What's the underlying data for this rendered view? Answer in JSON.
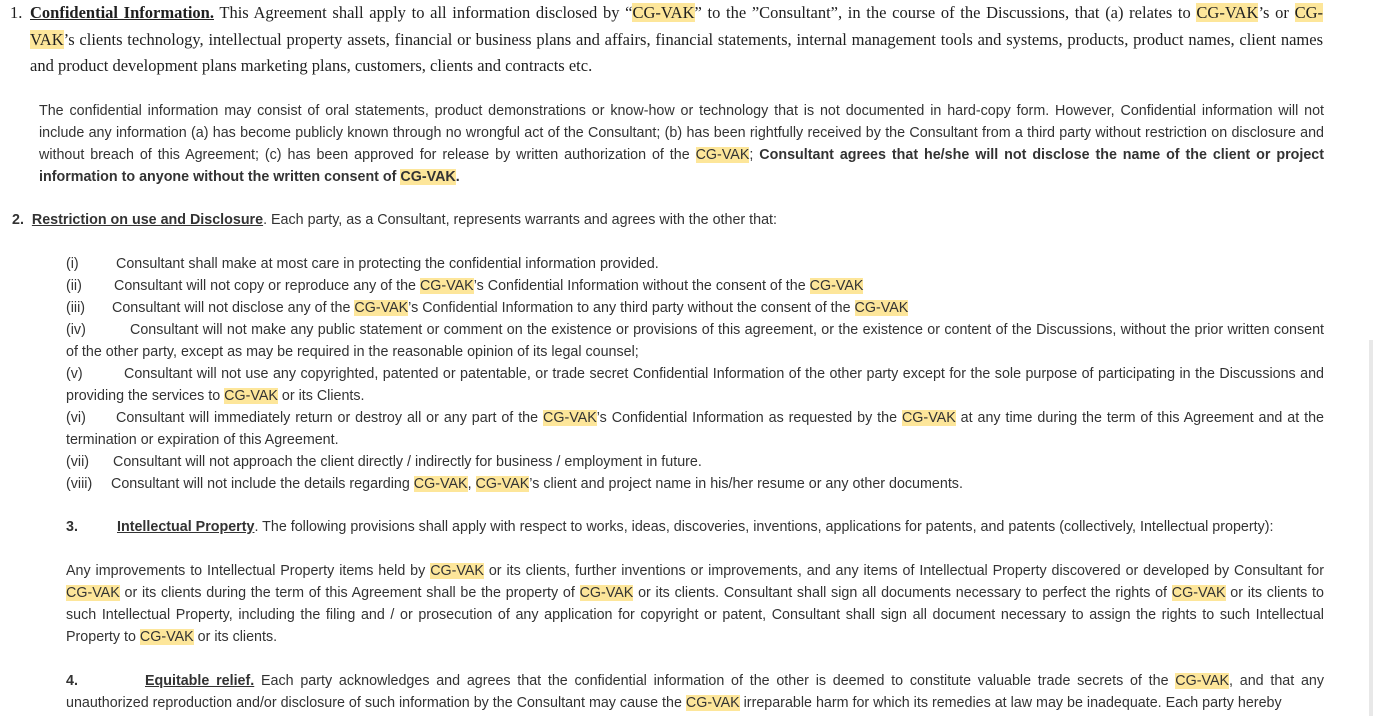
{
  "hl": "CG-VAK",
  "s1": {
    "num": "1.",
    "heading": "Confidential Information.",
    "text_a": " This Agreement shall apply to all information disclosed by  “",
    "text_b": "” to the ”Consultant”, in the course of the Discussions, that (a) relates to ",
    "text_c": "’s or ",
    "text_d": "’s clients technology, intellectual property assets, financial or business plans and affairs, financial statements, internal management tools and systems, products, product names, client names and product development plans marketing plans, customers, clients and contracts etc."
  },
  "p2": {
    "a": "The confidential information may consist of oral statements, product demonstrations or know-how or technology that is not documented in hard-copy form. However, Confidential information will not include any information (a) has become publicly known through no wrongful act of the Consultant; (b) has been rightfully received by the Consultant from a third party without restriction on disclosure and without breach of this Agreement; (c) has been approved for release by written authorization of the ",
    "b": "; ",
    "bold": "Consultant agrees that he/she will not disclose the name of the client or project information to anyone without the written consent of ",
    "end": "."
  },
  "s2": {
    "num": "2.",
    "heading": "Restriction on use and Disclosure",
    "text": ". Each party, as a Consultant, represents warrants and agrees with the other that:"
  },
  "items": {
    "i": {
      "n": "(i)",
      "t": "Consultant shall make at most care in protecting the confidential information provided."
    },
    "ii": {
      "n": "(ii)",
      "a": "Consultant will not copy or reproduce any of the ",
      "b": "’s Confidential Information without the consent of the "
    },
    "iii": {
      "n": "(iii)",
      "a": "Consultant will not disclose any of the ",
      "b": "’s Confidential Information to any third party without the consent of the "
    },
    "iv": {
      "n": "(iv)",
      "t": "Consultant will not make any public statement or comment on the existence or provisions of this agreement, or the existence or content of the Discussions, without the prior written consent of the other party, except as may be required in the reasonable opinion of its legal counsel;"
    },
    "v": {
      "n": "(v)",
      "a": "Consultant will not use any copyrighted, patented or patentable, or trade secret Confidential Information of the other party except for the sole purpose of participating in the Discussions and providing the services to ",
      "b": " or its Clients."
    },
    "vi": {
      "n": "(vi)",
      "a": "Consultant will immediately return or destroy all or any part of the ",
      "b": "’s Confidential Information as requested by the ",
      "c": " at any time during the term of this Agreement and at the termination or expiration of this Agreement."
    },
    "vii": {
      "n": "(vii)",
      "t": "Consultant will not approach the client directly / indirectly for business / employment in future."
    },
    "viii": {
      "n": "(viii)",
      "a": "Consultant will not include the details regarding ",
      "b": ", ",
      "c": "’s client and project name in his/her resume or any other documents."
    }
  },
  "s3": {
    "num": "3.",
    "heading": "Intellectual Property",
    "text": ". The following provisions shall apply with respect to works, ideas, discoveries, inventions, applications for patents, and patents (collectively, Intellectual property):"
  },
  "p3": {
    "a": "Any improvements to Intellectual Property items held by ",
    "b": " or its clients, further inventions or improvements, and any items of Intellectual Property discovered or developed by Consultant for ",
    "c": " or its clients during the term of this Agreement shall be the property of ",
    "d": " or its clients. Consultant shall sign all documents necessary to perfect the rights of ",
    "e": " or its clients to such Intellectual Property, including the filing and / or prosecution of any application for copyright or patent, Consultant shall sign all document necessary to assign the rights to such Intellectual Property to ",
    "f": " or its clients."
  },
  "s4": {
    "num": "4.",
    "heading": "Equitable relief.",
    "a": " Each party acknowledges and agrees that the confidential information of the other is deemed to constitute valuable trade secrets of the ",
    "b": ", and that any unauthorized reproduction and/or disclosure of such information by the Consultant may cause the ",
    "c": " irreparable harm for which its remedies at law may be inadequate.  Each party hereby"
  }
}
